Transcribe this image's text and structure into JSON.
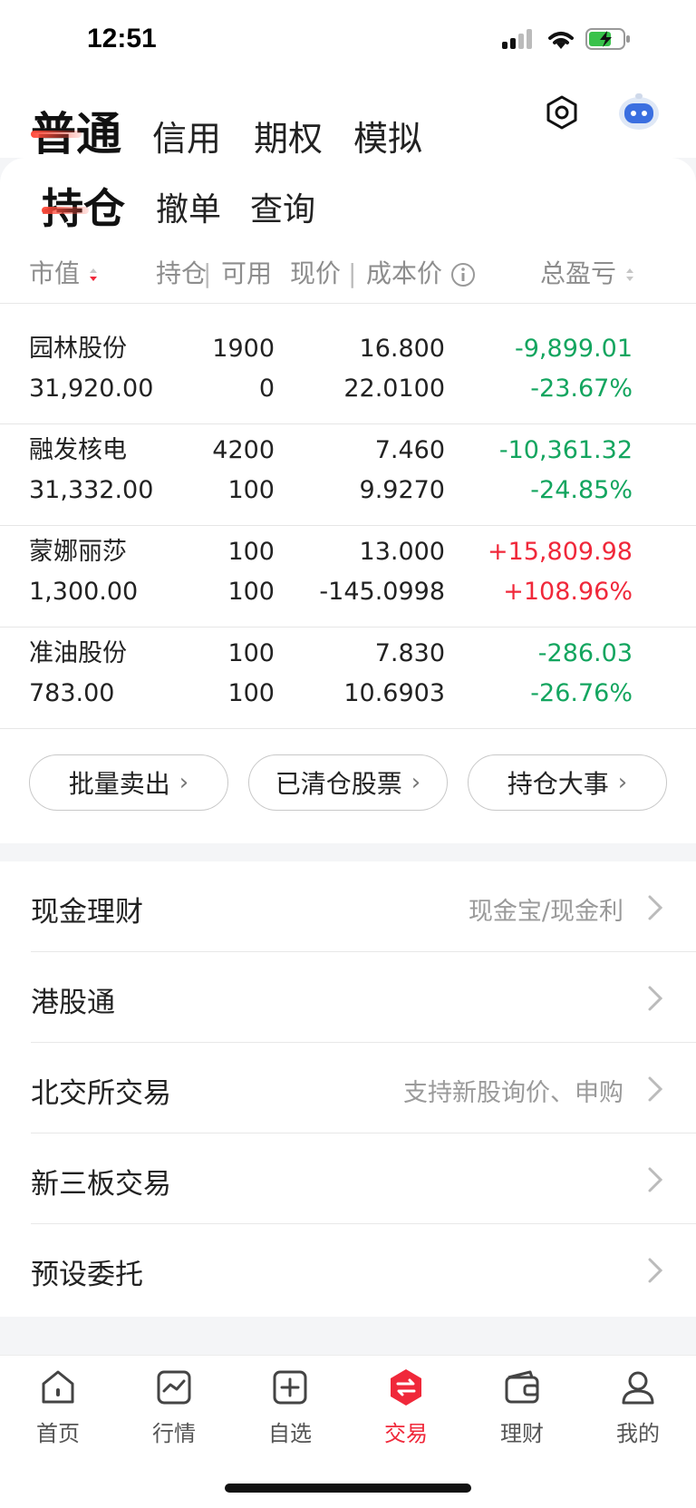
{
  "status": {
    "time": "12:51"
  },
  "top_tabs": [
    "普通",
    "信用",
    "期权",
    "模拟"
  ],
  "sub_tabs": [
    "持仓",
    "撤单",
    "查询"
  ],
  "columns": {
    "market_value": "市值",
    "position": "持仓",
    "available": "可用",
    "price": "现价",
    "cost": "成本价",
    "pnl": "总盈亏"
  },
  "holdings": [
    {
      "name": "园林股份",
      "value": "31,920.00",
      "position": "1900",
      "available": "0",
      "price": "16.800",
      "cost": "22.0100",
      "pnl": "-9,899.01",
      "pnl_pct": "-23.67%",
      "trend": "down"
    },
    {
      "name": "融发核电",
      "value": "31,332.00",
      "position": "4200",
      "available": "100",
      "price": "7.460",
      "cost": "9.9270",
      "pnl": "-10,361.32",
      "pnl_pct": "-24.85%",
      "trend": "down"
    },
    {
      "name": "蒙娜丽莎",
      "value": "1,300.00",
      "position": "100",
      "available": "100",
      "price": "13.000",
      "cost": "-145.0998",
      "pnl": "+15,809.98",
      "pnl_pct": "+108.96%",
      "trend": "up"
    },
    {
      "name": "准油股份",
      "value": "783.00",
      "position": "100",
      "available": "100",
      "price": "7.830",
      "cost": "10.6903",
      "pnl": "-286.03",
      "pnl_pct": "-26.76%",
      "trend": "down"
    }
  ],
  "actions": [
    "批量卖出",
    "已清仓股票",
    "持仓大事"
  ],
  "menu": [
    {
      "label": "现金理财",
      "hint": "现金宝/现金利"
    },
    {
      "label": "港股通",
      "hint": ""
    },
    {
      "label": "北交所交易",
      "hint": "支持新股询价、申购"
    },
    {
      "label": "新三板交易",
      "hint": ""
    },
    {
      "label": "预设委托",
      "hint": ""
    }
  ],
  "bottom_nav": [
    "首页",
    "行情",
    "自选",
    "交易",
    "理财",
    "我的"
  ],
  "colors": {
    "accent": "#f0283a",
    "up": "#f0283a",
    "down": "#13a55f"
  },
  "icons": {
    "settings": "hexagon-gear-icon",
    "assistant": "robot-avatar-icon",
    "nav": [
      "home-icon",
      "chart-icon",
      "plus-square-icon",
      "trade-icon",
      "wallet-icon",
      "user-icon"
    ]
  }
}
